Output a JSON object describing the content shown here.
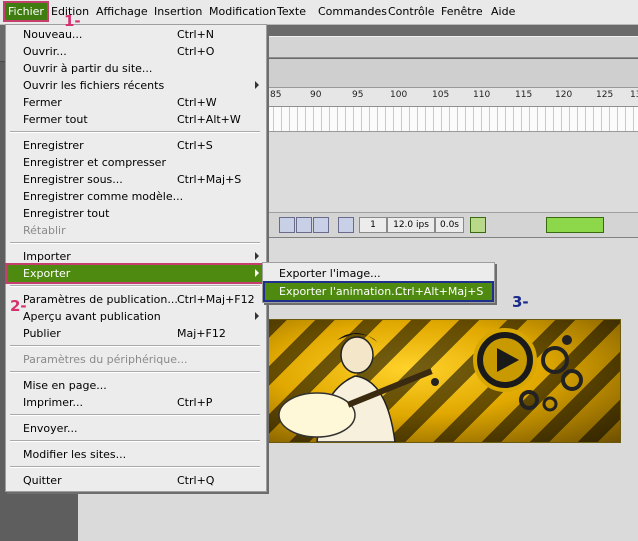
{
  "menubar": {
    "items": [
      "Fichier",
      "Edition",
      "Affichage",
      "Insertion",
      "Modification",
      "Texte",
      "Commandes",
      "Contrôle",
      "Fenêtre",
      "Aide"
    ]
  },
  "timeline": {
    "ruler": [
      "85",
      "90",
      "95",
      "100",
      "105",
      "110",
      "115",
      "120",
      "125",
      "13"
    ],
    "frame": "1",
    "fps": "12.0 ips",
    "time": "0.0s"
  },
  "fichier_menu": {
    "items": [
      {
        "label": "Nouveau...",
        "shortcut": "Ctrl+N"
      },
      {
        "label": "Ouvrir...",
        "shortcut": "Ctrl+O"
      },
      {
        "label": "Ouvrir à partir du site...",
        "shortcut": ""
      },
      {
        "label": "Ouvrir les fichiers récents",
        "shortcut": ""
      },
      {
        "label": "Fermer",
        "shortcut": "Ctrl+W"
      },
      {
        "label": "Fermer tout",
        "shortcut": "Ctrl+Alt+W"
      },
      {
        "label": "Enregistrer",
        "shortcut": "Ctrl+S"
      },
      {
        "label": "Enregistrer et compresser",
        "shortcut": ""
      },
      {
        "label": "Enregistrer sous...",
        "shortcut": "Ctrl+Maj+S"
      },
      {
        "label": "Enregistrer comme modèle...",
        "shortcut": ""
      },
      {
        "label": "Enregistrer tout",
        "shortcut": ""
      },
      {
        "label": "Rétablir",
        "shortcut": ""
      },
      {
        "label": "Importer",
        "shortcut": ""
      },
      {
        "label": "Exporter",
        "shortcut": ""
      },
      {
        "label": "Paramètres de publication...",
        "shortcut": "Ctrl+Maj+F12"
      },
      {
        "label": "Aperçu avant publication",
        "shortcut": ""
      },
      {
        "label": "Publier",
        "shortcut": "Maj+F12"
      },
      {
        "label": "Paramètres du périphérique...",
        "shortcut": ""
      },
      {
        "label": "Mise en page...",
        "shortcut": ""
      },
      {
        "label": "Imprimer...",
        "shortcut": "Ctrl+P"
      },
      {
        "label": "Envoyer...",
        "shortcut": ""
      },
      {
        "label": "Modifier les sites...",
        "shortcut": ""
      },
      {
        "label": "Quitter",
        "shortcut": "Ctrl+Q"
      }
    ]
  },
  "exporter_submenu": {
    "items": [
      {
        "label": "Exporter l'image...",
        "shortcut": ""
      },
      {
        "label": "Exporter l'animation...",
        "shortcut": "Ctrl+Alt+Maj+S"
      }
    ]
  },
  "steps": [
    "1-",
    "2-",
    "3-"
  ],
  "colors": {
    "highlight_green": "#4e8a10",
    "step1": "#d6306e",
    "step2": "#d6306e",
    "step3": "#1a2a8a"
  }
}
